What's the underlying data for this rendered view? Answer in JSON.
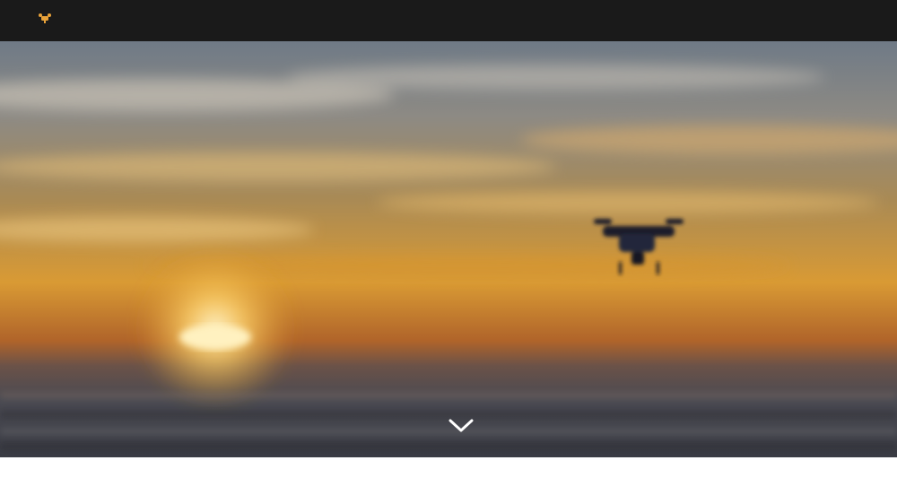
{
  "header": {
    "logo_text": "",
    "logo_icon": "drone-logo-icon",
    "nav": [
      {
        "label": ""
      },
      {
        "label": ""
      },
      {
        "label": ""
      },
      {
        "label": ""
      }
    ]
  },
  "hero": {
    "title": "",
    "subtitle": "",
    "scroll_icon": "chevron-down-icon"
  },
  "colors": {
    "header_bg": "#1a1a1a",
    "accent": "#e8a23a",
    "sky_top": "#6f7a86",
    "sunset": "#e09a2a",
    "sea": "#3f4149"
  }
}
